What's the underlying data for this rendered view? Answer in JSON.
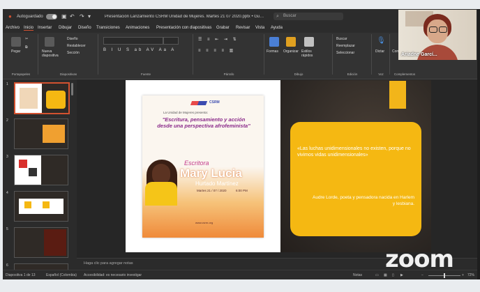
{
  "titlebar": {
    "autosave_label": "Autoguardado",
    "document_title": "Presentación Lanzamiento CSRM Unidad de Mujeres. Martes 21 07 2020.pptx • Guardado",
    "search_placeholder": "Buscar"
  },
  "menu": [
    "Archivo",
    "Inicio",
    "Insertar",
    "Dibujar",
    "Diseño",
    "Transiciones",
    "Animaciones",
    "Presentación con diapositivas",
    "Grabar",
    "Revisar",
    "Vista",
    "Ayuda"
  ],
  "menu_active": "Inicio",
  "ribbon": {
    "groups": {
      "clipboard": "Portapapeles",
      "slides": "Diapositivas",
      "font": "Fuente",
      "paragraph": "Párrafo",
      "drawing": "Dibujo",
      "editing": "Edición",
      "voice": "Voz",
      "addins": "Complementos"
    },
    "buttons": {
      "paste": "Pegar",
      "new_slide": "Nueva diapositiva",
      "layout": "Diseño",
      "reset": "Restablecer",
      "section": "Sección",
      "shapes": "Formas",
      "arrange": "Organizar",
      "quick_styles": "Estilos rápidos",
      "find": "Buscar",
      "replace": "Reemplazar",
      "select": "Seleccionar",
      "dictate": "Dictar",
      "addins": "Complementos"
    }
  },
  "thumbnails": [
    {
      "num": "1",
      "selected": true
    },
    {
      "num": "2",
      "selected": false
    },
    {
      "num": "3",
      "selected": false
    },
    {
      "num": "4",
      "selected": false
    },
    {
      "num": "5",
      "selected": false
    },
    {
      "num": "6",
      "selected": false
    }
  ],
  "poster": {
    "org": "CSRM",
    "subtitle": "La Unidad de Mujeres presenta:",
    "headline": "\"Escritura, pensamiento y acción desde una perspectiva afrofeminista\"",
    "role": "Escritora",
    "name_first": "Mary Lucia",
    "name_last": "Hurtado Martínez",
    "date": "Martes 21 / 07 / 2020",
    "time": "6:00 PM",
    "footer": "www.csrm.org"
  },
  "slide_quote": {
    "quote": "«Las luchas unidimensionales no existen, porque no vivimos vidas unidimensionales»",
    "author": "Audre Lorde, poeta y pensadora nacida en Harlem y lesbiana."
  },
  "notes_placeholder": "Haga clic para agregar notas",
  "statusbar": {
    "slide_info": "Diapositiva 1 de 13",
    "language": "Español (Colombia)",
    "accessibility": "Accesibilidad: es necesario investigar",
    "notes": "Notas",
    "zoom": "72%"
  },
  "video": {
    "participant_name": "Ariadne Garcí..."
  },
  "zoom_logo": "zoom",
  "colors": {
    "accent": "#d35230",
    "slide_yellow": "#f5b812"
  }
}
